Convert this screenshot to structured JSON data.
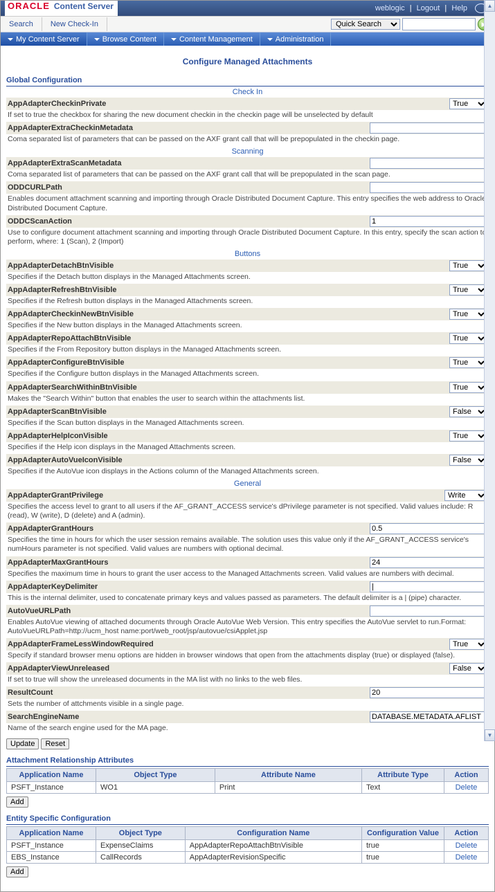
{
  "brand": {
    "vendor": "ORACLE",
    "product": "Content Server"
  },
  "toplinks": {
    "user": "weblogic",
    "logout": "Logout",
    "help": "Help"
  },
  "tabs": {
    "search": "Search",
    "newcheckin": "New Check-In"
  },
  "quickSearch": {
    "dropdown": "Quick Search",
    "placeholder": ""
  },
  "menu": {
    "mycontent": "My Content Server",
    "browse": "Browse Content",
    "contentmgmt": "Content Management",
    "admin": "Administration"
  },
  "page": {
    "title": "Configure Managed Attachments"
  },
  "sections": {
    "global": "Global Configuration",
    "checkin": "Check In",
    "scanning": "Scanning",
    "buttons": "Buttons",
    "general": "General",
    "attrel": "Attachment Relationship Attributes",
    "entity": "Entity Specific Configuration"
  },
  "params": {
    "checkinPrivate": {
      "name": "AppAdapterCheckinPrivate",
      "desc": "If set to true the checkbox for sharing the new document checkin in the checkin page will be unselected by default",
      "value": "True"
    },
    "extraCheckinMeta": {
      "name": "AppAdapterExtraCheckinMetadata",
      "desc": "Coma separated list of parameters that can be passed on the AXF grant call that will be prepopulated in the checkin page.",
      "value": ""
    },
    "extraScanMeta": {
      "name": "AppAdapterExtraScanMetadata",
      "desc": "Coma separated list of parameters that can be passed on the AXF grant call that will be prepopulated in the scan page.",
      "value": ""
    },
    "oddcUrl": {
      "name": "ODDCURLPath",
      "desc": "Enables document attachment scanning and importing through Oracle Distributed Document Capture. This entry specifies the web address to Oracle Distributed Document Capture.",
      "value": ""
    },
    "oddcScan": {
      "name": "ODDCScanAction",
      "desc": "Use to configure document attachment scanning and importing through Oracle Distributed Document Capture. In this entry, specify the scan action to perform, where: 1 (Scan), 2 (Import)",
      "value": "1"
    },
    "detachBtn": {
      "name": "AppAdapterDetachBtnVisible",
      "desc": "Specifies if the Detach button displays in the Managed Attachments screen.",
      "value": "True"
    },
    "refreshBtn": {
      "name": "AppAdapterRefreshBtnVisible",
      "desc": "Specifies if the Refresh button displays in the Managed Attachments screen.",
      "value": "True"
    },
    "checkinNewBtn": {
      "name": "AppAdapterCheckinNewBtnVisible",
      "desc": "Specifies if the New button displays in the Managed Attachments screen.",
      "value": "True"
    },
    "repoAttachBtn": {
      "name": "AppAdapterRepoAttachBtnVisible",
      "desc": "Specifies if the From Repository button displays in the Managed Attachments screen.",
      "value": "True"
    },
    "configureBtn": {
      "name": "AppAdapterConfigureBtnVisible",
      "desc": "Specifies if the Configure button displays in the Managed Attachments screen.",
      "value": "True"
    },
    "searchWithinBtn": {
      "name": "AppAdapterSearchWithinBtnVisible",
      "desc": "Makes the \"Search Within\" button that enables the user to search within the attachments list.",
      "value": "True"
    },
    "scanBtn": {
      "name": "AppAdapterScanBtnVisible",
      "desc": "Specifies if the Scan button displays in the Managed Attachments screen.",
      "value": "False"
    },
    "helpIcon": {
      "name": "AppAdapterHelpIconVisible",
      "desc": "Specifies if the Help icon displays in the Managed Attachments screen.",
      "value": "True"
    },
    "autovueIcon": {
      "name": "AppAdapterAutoVueIconVisible",
      "desc": "Specifies if the AutoVue icon displays in the Actions column of the Managed Attachments screen.",
      "value": "False"
    },
    "grantPriv": {
      "name": "AppAdapterGrantPrivilege",
      "desc": "Specifies the access level to grant to all users if the AF_GRANT_ACCESS service's dPrivilege parameter is not specified. Valid values include: R (read), W (write), D (delete) and A (admin).",
      "value": "Write"
    },
    "grantHours": {
      "name": "AppAdapterGrantHours",
      "desc": "Specifies the time in hours for which the user session remains available. The solution uses this value only if the AF_GRANT_ACCESS service's numHours parameter is not specified. Valid values are numbers with optional decimal.",
      "value": "0.5"
    },
    "maxGrantHours": {
      "name": "AppAdapterMaxGrantHours",
      "desc": "Specifies the maximum time in hours to grant the user access to the Managed Attachments screen. Valid values are numbers with decimal.",
      "value": "24"
    },
    "keyDelim": {
      "name": "AppAdapterKeyDelimiter",
      "desc": "This is the internal delimiter, used to concatenate primary keys and values passed as parameters. The default delimiter is a | (pipe) character.",
      "value": "|"
    },
    "autoVueUrl": {
      "name": "AutoVueURLPath",
      "desc": "Enables AutoVue viewing of attached documents through Oracle AutoVue Web Version. This entry specifies the AutoVue servlet to run.Format: AutoVueURLPath=http://ucm_host name:port/web_root/jsp/autovue/csiApplet.jsp",
      "value": ""
    },
    "frameless": {
      "name": "AppAdapterFrameLessWindowRequired",
      "desc": "Specify if standard browser menu options are hidden in browser windows that open from the attachments display (true) or displayed (false).",
      "value": "True"
    },
    "viewUnrel": {
      "name": "AppAdapterViewUnreleased",
      "desc": "If set to true will show the unreleased documents in the MA list with no links to the web files.",
      "value": "False"
    },
    "resultCount": {
      "name": "ResultCount",
      "desc": "Sets the number of attchments visible in a single page.",
      "value": "20"
    },
    "searchEngine": {
      "name": "SearchEngineName",
      "desc": "Name of the search engine used for the MA page.",
      "value": "DATABASE.METADATA.AFLIST"
    }
  },
  "buttons": {
    "update": "Update",
    "reset": "Reset",
    "add": "Add"
  },
  "attrelTable": {
    "headers": [
      "Application Name",
      "Object Type",
      "Attribute Name",
      "Attribute Type",
      "Action"
    ],
    "row": {
      "app": "PSFT_Instance",
      "obj": "WO1",
      "attr": "Print",
      "type": "Text",
      "action": "Delete"
    }
  },
  "entityTable": {
    "headers": [
      "Application Name",
      "Object Type",
      "Configuration Name",
      "Configuration Value",
      "Action"
    ],
    "rows": [
      {
        "app": "PSFT_Instance",
        "obj": "ExpenseClaims",
        "conf": "AppAdapterRepoAttachBtnVisible",
        "val": "true",
        "action": "Delete"
      },
      {
        "app": "EBS_Instance",
        "obj": "CallRecords",
        "conf": "AppAdapterRevisionSpecific",
        "val": "true",
        "action": "Delete"
      }
    ]
  }
}
